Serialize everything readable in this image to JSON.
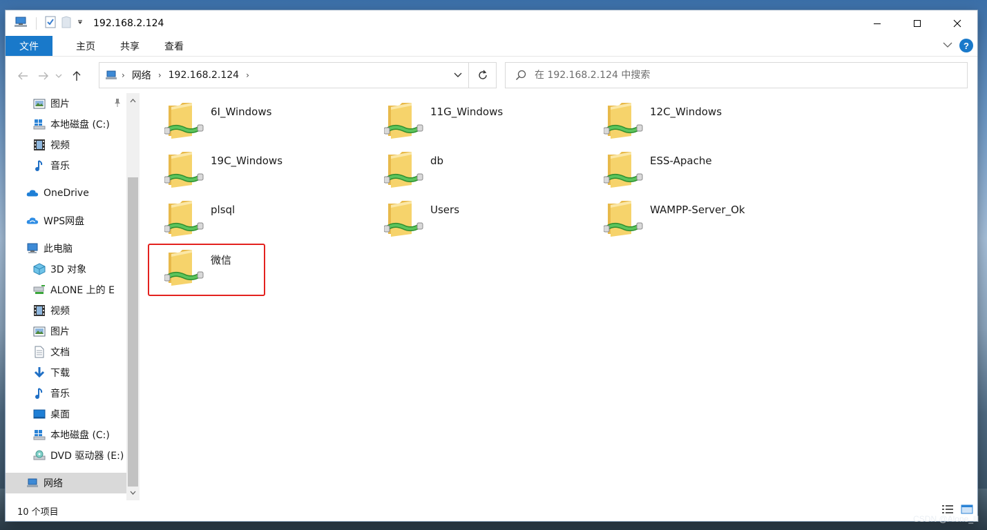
{
  "window": {
    "title": "192.168.2.124"
  },
  "ribbon": {
    "tabs": [
      {
        "label": "文件"
      },
      {
        "label": "主页"
      },
      {
        "label": "共享"
      },
      {
        "label": "查看"
      }
    ],
    "help_label": "?"
  },
  "address": {
    "crumbs": [
      "网络",
      "192.168.2.124"
    ],
    "separator": "›"
  },
  "search": {
    "placeholder": "在 192.168.2.124 中搜索"
  },
  "nav": {
    "items": [
      {
        "label": "图片",
        "icon": "pictures-icon"
      },
      {
        "label": "本地磁盘 (C:)",
        "icon": "local-disk-icon"
      },
      {
        "label": "视频",
        "icon": "videos-icon"
      },
      {
        "label": "音乐",
        "icon": "music-icon"
      },
      {
        "label": "OneDrive",
        "icon": "onedrive-icon"
      },
      {
        "label": "WPS网盘",
        "icon": "wps-cloud-icon"
      },
      {
        "label": "此电脑",
        "icon": "this-pc-icon"
      },
      {
        "label": "3D 对象",
        "icon": "3d-objects-icon"
      },
      {
        "label": "ALONE 上的 E",
        "icon": "network-drive-icon"
      },
      {
        "label": "视频",
        "icon": "videos-icon"
      },
      {
        "label": "图片",
        "icon": "pictures-icon"
      },
      {
        "label": "文档",
        "icon": "documents-icon"
      },
      {
        "label": "下载",
        "icon": "downloads-icon"
      },
      {
        "label": "音乐",
        "icon": "music-icon"
      },
      {
        "label": "桌面",
        "icon": "desktop-icon"
      },
      {
        "label": "本地磁盘 (C:)",
        "icon": "local-disk-icon"
      },
      {
        "label": "DVD 驱动器 (E:)",
        "icon": "dvd-drive-icon"
      },
      {
        "label": "网络",
        "icon": "network-icon",
        "selected": true
      }
    ]
  },
  "folders": [
    {
      "name": "6I_Windows"
    },
    {
      "name": "11G_Windows"
    },
    {
      "name": "12C_Windows"
    },
    {
      "name": "19C_Windows"
    },
    {
      "name": "db"
    },
    {
      "name": "ESS-Apache"
    },
    {
      "name": "plsql"
    },
    {
      "name": "Users"
    },
    {
      "name": "WAMPP-Server_Ok"
    },
    {
      "name": "微信",
      "highlighted": true
    }
  ],
  "status": {
    "item_count": "10 个项目"
  },
  "watermark": "CSDN @Alone_lll",
  "colors": {
    "accent": "#1979ca",
    "highlight_box": "#e3211e",
    "selected_nav": "#d9d9d9",
    "folder": "#f6d36b",
    "share_pipe": "#3aa63a"
  }
}
